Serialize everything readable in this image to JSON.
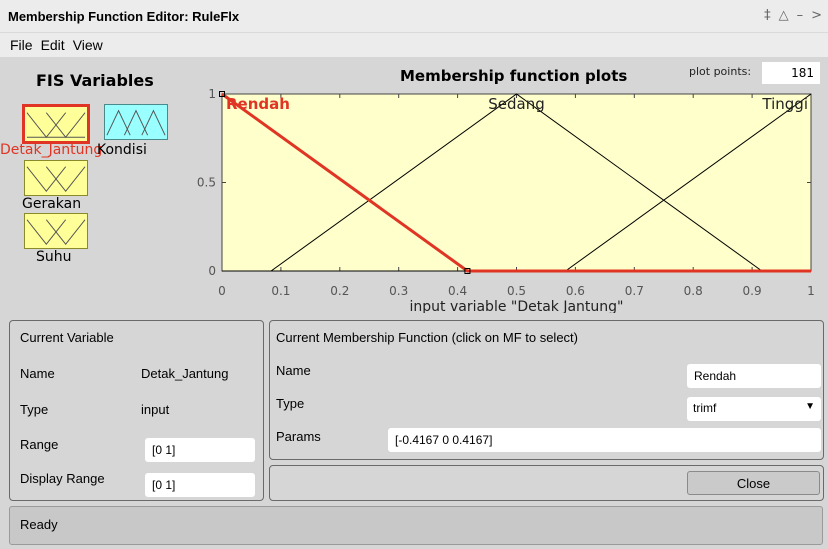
{
  "window": {
    "title": "Membership Function Editor: RuleFlx",
    "controls": [
      "‡",
      "△",
      "–",
      ">"
    ]
  },
  "menu": [
    "File",
    "Edit",
    "View"
  ],
  "fis": {
    "title": "FIS Variables",
    "variables": [
      {
        "name": "Detak_Jantung",
        "type": "input",
        "selected": true
      },
      {
        "name": "Kondisi",
        "type": "output",
        "selected": false
      },
      {
        "name": "Gerakan",
        "type": "input",
        "selected": false
      },
      {
        "name": "Suhu",
        "type": "input",
        "selected": false
      }
    ]
  },
  "plot": {
    "title": "Membership function plots",
    "plot_points_label": "plot points:",
    "plot_points_value": "181",
    "xlabel": "input variable \"Detak Jantung\"",
    "xticks": [
      "0",
      "0.1",
      "0.2",
      "0.3",
      "0.4",
      "0.5",
      "0.6",
      "0.7",
      "0.8",
      "0.9",
      "1"
    ],
    "yticks": [
      "0",
      "0.5",
      "1"
    ],
    "colors": {
      "background": "#ffffcc",
      "selected": "#e03524",
      "normal": "#000000"
    }
  },
  "chart_data": {
    "type": "line",
    "xlabel": "input variable \"Detak Jantung\"",
    "xlim": [
      0,
      1
    ],
    "ylim": [
      0,
      1
    ],
    "series": [
      {
        "name": "Rendah",
        "points": [
          [
            0,
            1
          ],
          [
            0.4167,
            0
          ],
          [
            1,
            0
          ]
        ],
        "selected": true
      },
      {
        "name": "Sedang",
        "points": [
          [
            0,
            0
          ],
          [
            0.0833,
            0
          ],
          [
            0.5,
            1
          ],
          [
            0.9167,
            0
          ],
          [
            1,
            0
          ]
        ],
        "selected": false
      },
      {
        "name": "Tinggi",
        "points": [
          [
            0,
            0
          ],
          [
            0.5833,
            0
          ],
          [
            1,
            1
          ]
        ],
        "selected": false
      }
    ]
  },
  "current_variable": {
    "header": "Current Variable",
    "name_label": "Name",
    "name_value": "Detak_Jantung",
    "type_label": "Type",
    "type_value": "input",
    "range_label": "Range",
    "range_value": "[0 1]",
    "display_range_label": "Display Range",
    "display_range_value": "[0 1]"
  },
  "current_mf": {
    "header": "Current Membership Function (click on MF to select)",
    "name_label": "Name",
    "name_value": "Rendah",
    "type_label": "Type",
    "type_value": "trimf",
    "params_label": "Params",
    "params_value": "[-0.4167 0 0.4167]"
  },
  "close_label": "Close",
  "status": "Ready"
}
